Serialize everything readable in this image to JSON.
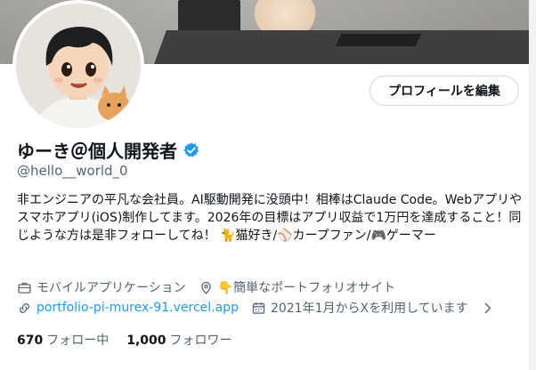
{
  "profile": {
    "display_name": "ゆーき＠個人開発者",
    "handle": "@hello__world_0",
    "edit_label": "プロフィールを編集",
    "bio": "非エンジニアの平凡な会社員。AI駆動開発に没頭中！相棒はClaude Code。Webアプリやスマホアプリ(iOS)制作してます。2026年の目標はアプリ収益で1万円を達成すること！同じような方は是非フォローしてね！ 🐈猫好き/⚾カープファン/🎮ゲーマー",
    "category": "モバイルアプリケーション",
    "location": "👇簡単なポートフォリオサイト",
    "website": "portfolio-pi-murex-91.vercel.app",
    "joined": "2021年1月からXを利用しています",
    "following_count": "670",
    "following_label": "フォロー中",
    "followers_count": "1,000",
    "followers_label": "フォロワー"
  },
  "colors": {
    "accent": "#1d9bf0",
    "text": "#0f1419",
    "secondary": "#536471"
  },
  "icons": {
    "verified": "verified-badge-icon",
    "category": "briefcase-icon",
    "location": "location-pin-icon",
    "website": "link-icon",
    "joined": "calendar-icon",
    "joined_more": "chevron-right-icon"
  }
}
